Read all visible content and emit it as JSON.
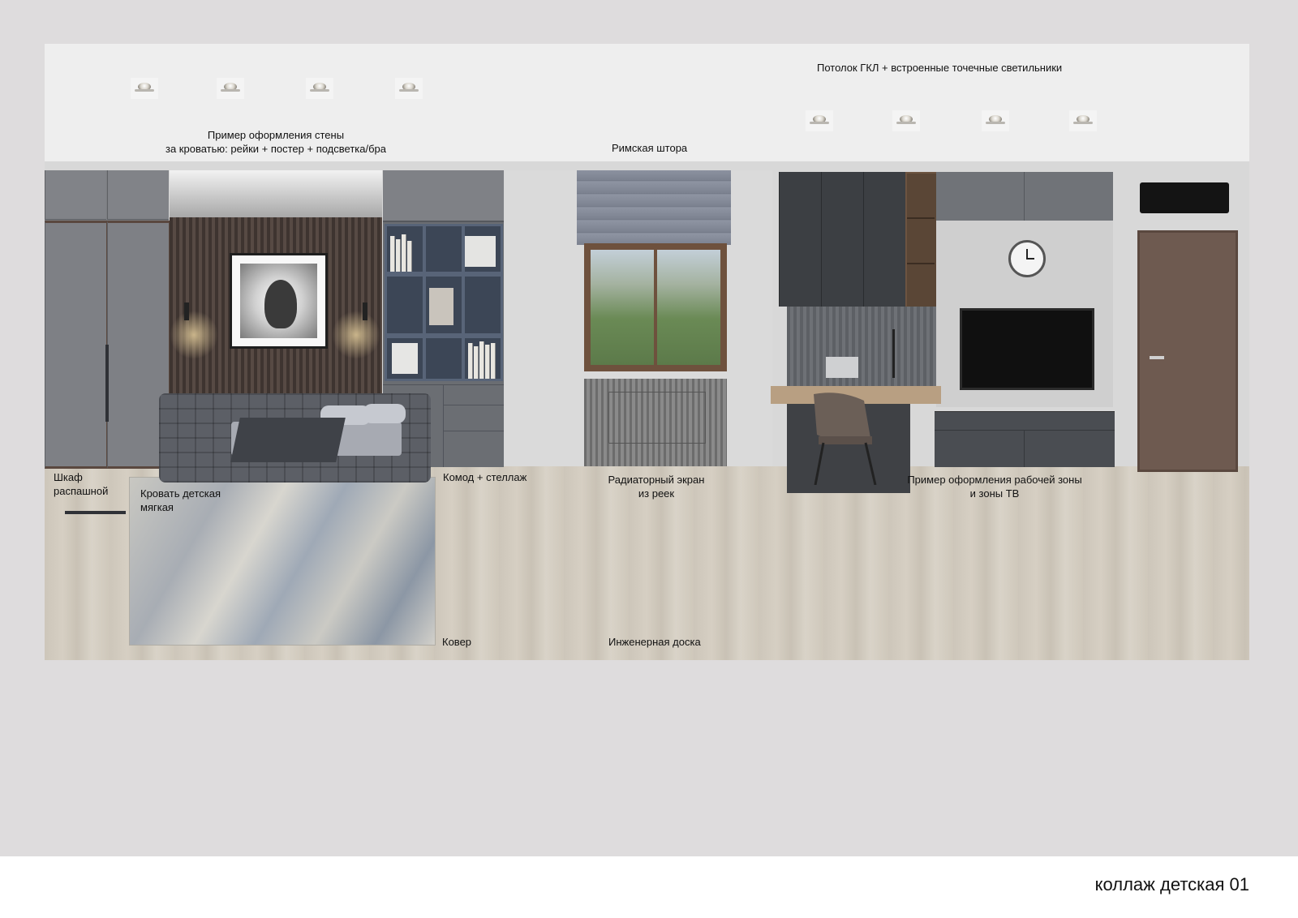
{
  "labels": {
    "ceiling": "Потолок ГКЛ + встроенные точечные светильники",
    "wall_example_line1": "Пример оформления стены",
    "wall_example_line2": "за кроватью: рейки + постер + подсветка/бра",
    "roman_blind": "Римская штора",
    "wardrobe_line1": "Шкаф",
    "wardrobe_line2": "распашной",
    "bed_line1": "Кровать детская",
    "bed_line2": "мягкая",
    "dresser": "Комод + стеллаж",
    "radiator_line1": "Радиаторный экран",
    "radiator_line2": "из реек",
    "workzone_line1": "Пример оформления рабочей зоны",
    "workzone_line2": "и зоны ТВ",
    "rug": "Ковер",
    "floor": "Инженерная доска"
  },
  "caption": "коллаж детская 01",
  "colors": {
    "page_bg": "#dedcdd",
    "ceiling": "#eeeeee",
    "footer": "#ffffff",
    "floor": "#d2cbbf",
    "furniture_gray": "#7a7c80"
  },
  "icons": [
    "spotlight-icon",
    "wall-clock-icon",
    "air-conditioner-icon",
    "door-handle-icon"
  ]
}
